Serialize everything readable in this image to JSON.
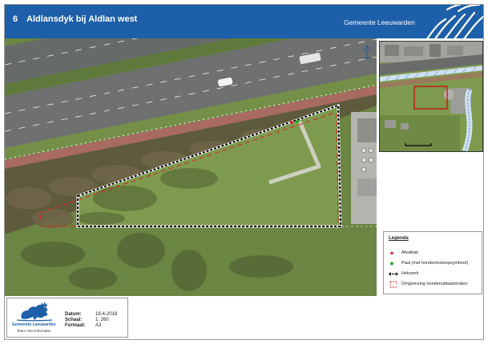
{
  "header": {
    "number": "6",
    "title": "Aldlansdyk bij Aldlan west",
    "brand": "Gemeente Leeuwarden"
  },
  "legend": {
    "title": "Legenda",
    "items": [
      {
        "label": "Afvalbak",
        "icon": "waste-bin-dot",
        "color": "#d9262c"
      },
      {
        "label": "Paal (met hondenlosloopsymbool)",
        "icon": "post-dot",
        "color": "#2aa82a"
      },
      {
        "label": "Hekwerk",
        "icon": "fence-line",
        "color": "#000000"
      },
      {
        "label": "Omgrenzing hondenuitlaatstroken",
        "icon": "dog-zone-outline",
        "color": "#e02020"
      }
    ]
  },
  "info": {
    "org": "Gemeente Leeuwarden",
    "team": "Team Geo-informatie",
    "rows": [
      {
        "label": "Datum:",
        "value": "18-4-2018"
      },
      {
        "label": "Schaal:",
        "value": "1: 260"
      },
      {
        "label": "Formaat:",
        "value": "A3"
      }
    ]
  },
  "colors": {
    "header": "#1d5fa8",
    "fence": "#000000",
    "dog_zone": "#e02020",
    "waste_bin": "#d9262c",
    "post": "#2aa82a"
  }
}
